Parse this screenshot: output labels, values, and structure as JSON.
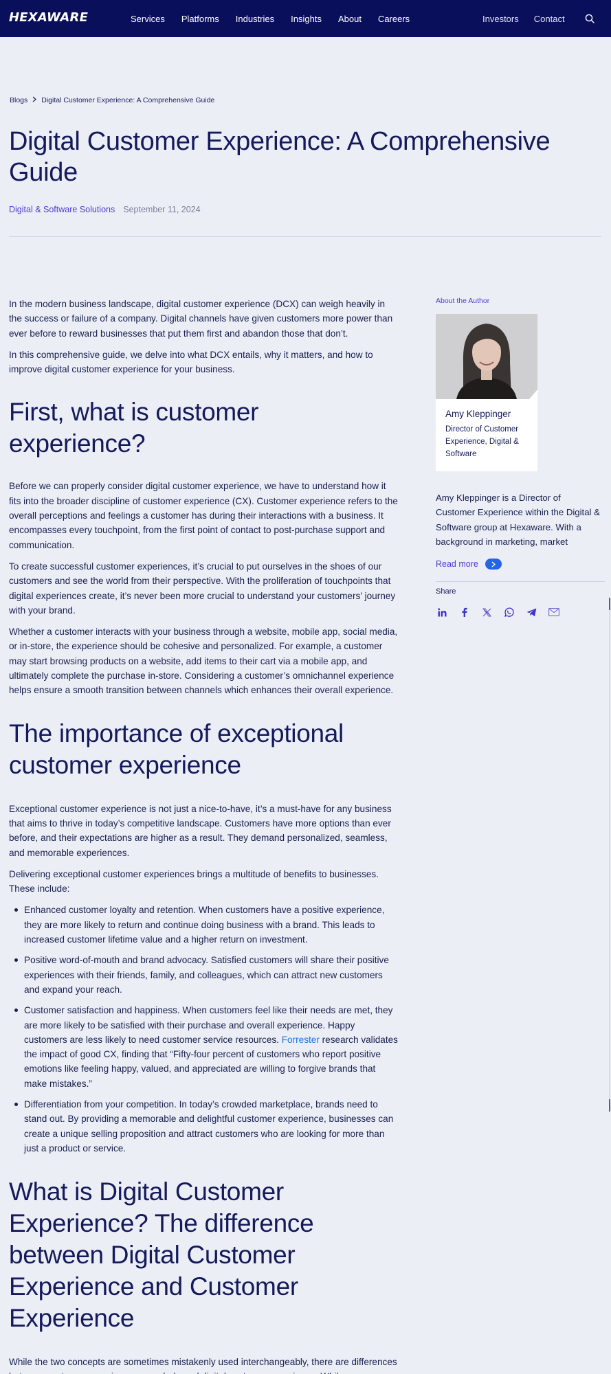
{
  "nav": {
    "logo": "HEXAWARE",
    "links": [
      "Services",
      "Platforms",
      "Industries",
      "Insights",
      "About",
      "Careers"
    ],
    "right_links": [
      "Investors",
      "Contact"
    ],
    "search_icon": "search-icon"
  },
  "breadcrumb": {
    "root": "Blogs",
    "current": "Digital Customer Experience: A Comprehensive Guide"
  },
  "title": "Digital Customer Experience: A Comprehensive Guide",
  "meta": {
    "category": "Digital & Software Solutions",
    "date": "September 11, 2024"
  },
  "article": {
    "intro_1": "In the modern business landscape, digital customer experience (DCX) can weigh heavily in the success or failure of a company. Digital channels have given customers more power than ever before to reward businesses that put them first and abandon those that don’t.",
    "intro_2": "In this comprehensive guide, we delve into what DCX entails, why it matters, and how to improve digital customer experience for your business.",
    "h2_1": "First, what is customer experience?",
    "p1_1": "Before we can properly consider digital customer experience, we have to understand how it fits into the broader discipline of customer experience (CX). Customer experience refers to the overall perceptions and feelings a customer has during their interactions with a business. It encompasses every touchpoint, from the first point of contact to post-purchase support and communication.",
    "p1_2": "To create successful customer experiences, it’s crucial to put ourselves in the shoes of our customers and see the world from their perspective. With the proliferation of touchpoints that digital experiences create, it’s never been more crucial to understand your customers’ journey with your brand.",
    "p1_3": "Whether a customer interacts with your business through a website, mobile app, social media, or in-store, the experience should be cohesive and personalized. For example, a customer may start browsing products on a website, add items to their cart via a mobile app, and ultimately complete the purchase in-store. Considering a customer’s omnichannel experience helps ensure a smooth transition between channels which enhances their overall experience.",
    "h2_2": "The importance of exceptional customer experience",
    "p2_1": "Exceptional customer experience is not just a nice-to-have, it’s a must-have for any business that aims to thrive in today’s competitive landscape. Customers have more options than ever before, and their expectations are higher as a result. They demand personalized, seamless, and memorable experiences.",
    "p2_2": "Delivering exceptional customer experiences brings a multitude of benefits to businesses. These include:",
    "bullets": [
      "Enhanced customer loyalty and retention. When customers have a positive experience, they are more likely to return and continue doing business with a brand. This leads to increased customer lifetime value and a higher return on investment.",
      "Positive word-of-mouth and brand advocacy. Satisfied customers will share their positive experiences with their friends, family, and colleagues, which can attract new customers and expand your reach."
    ],
    "bullet3_before": "Customer satisfaction and happiness. When customers feel like their needs are met, they are more likely to be satisfied with their purchase and overall experience. Happy customers are less likely to need customer service resources. ",
    "bullet3_link": "Forrester",
    "bullet3_after": " research validates the impact of good CX, finding that “Fifty-four percent of customers who report positive emotions like feeling happy, valued, and appreciated are willing to forgive brands that make mistakes.”",
    "bullet4": "Differentiation from your competition. In today’s crowded marketplace, brands need to stand out. By providing a memorable and delightful customer experience, businesses can create a unique selling proposition and attract customers who are looking for more than just a product or service.",
    "h2_3": "What is Digital Customer Experience? The difference between Digital Customer Experience and Customer Experience",
    "p3_1": "While the two concepts are sometimes mistakenly used interchangeably, there are differences between customer experience as a whole and digital customer experience. While"
  },
  "sidebar": {
    "about_label": "About the Author",
    "author_name": "Amy Kleppinger",
    "author_role": "Director of Customer Experience, Digital & Software",
    "bio": "Amy Kleppinger is a Director of Customer Experience within the Digital & Software group at Hexaware. With a background in marketing, market research, and product management, she leads customer experience initiatives.",
    "read_more": "Read more",
    "share_label": "Share",
    "share_icons": [
      "linkedin-icon",
      "facebook-icon",
      "x-icon",
      "whatsapp-icon",
      "telegram-icon",
      "email-icon"
    ]
  },
  "colors": {
    "nav_bg": "#0a0f5c",
    "page_bg": "#eceef5",
    "accent": "#4a3cd6",
    "link": "#1a73e8",
    "heading": "#141a5c"
  }
}
